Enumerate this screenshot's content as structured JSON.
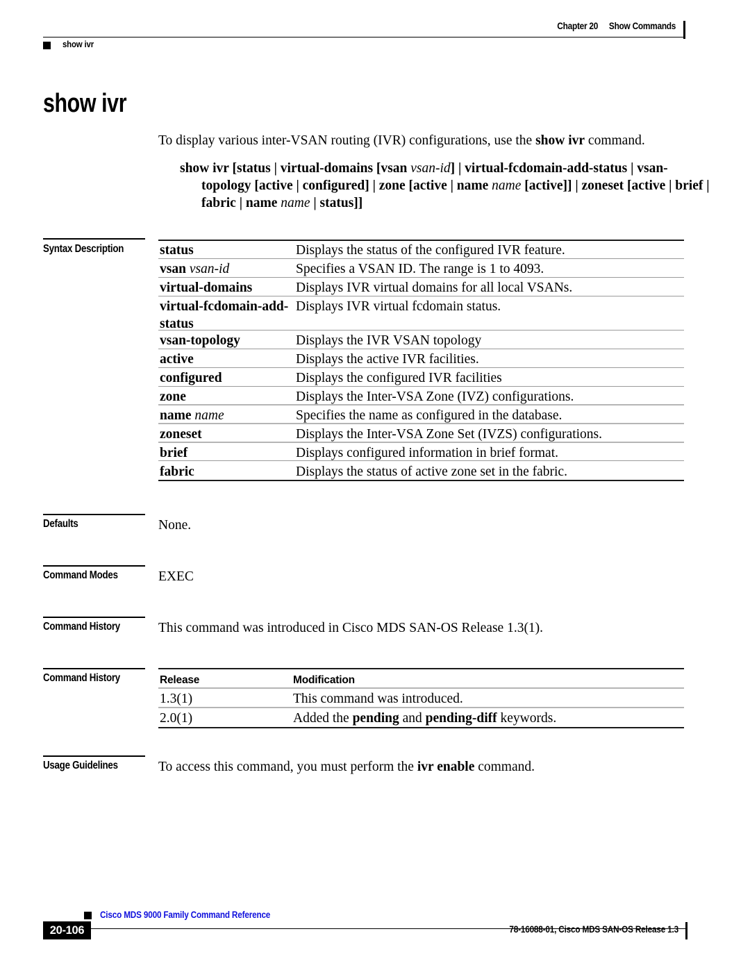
{
  "header": {
    "chapter": "Chapter 20",
    "section": "Show Commands",
    "running_head": "show ivr"
  },
  "title": "show ivr",
  "intro": {
    "prefix": "To display various inter-VSAN routing (IVR) configurations, use the ",
    "command": "show ivr",
    "suffix": " command."
  },
  "syntax": {
    "line1_a": "show ivr [status | virtual-domains [vsan ",
    "line1_i": "vsan-id",
    "line1_b": "] | virtual-fcdomain-add-status | vsan-topology [active | configured] | zone [active | name ",
    "line2_i": "name",
    "line2_b": " [active]] | zoneset [active | brief | fabric | name ",
    "line3_i": "name",
    "line3_b": " | status]]"
  },
  "sections": {
    "syntax_description": "Syntax Description",
    "defaults": "Defaults",
    "command_modes": "Command Modes",
    "command_history": "Command History",
    "command_history2": "Command History",
    "usage_guidelines": "Usage Guidelines"
  },
  "syntax_table": [
    {
      "term": "status",
      "term_italic": "",
      "desc": "Displays the status of the configured IVR feature."
    },
    {
      "term": "vsan",
      "term_italic": "vsan-id",
      "desc": "Specifies a VSAN ID. The range is 1 to 4093."
    },
    {
      "term": "virtual-domains",
      "term_italic": "",
      "desc": "Displays IVR virtual domains for all local VSANs."
    },
    {
      "term": "virtual-fcdomain-add-status",
      "term_italic": "",
      "desc": "Displays IVR virtual fcdomain status."
    },
    {
      "term": "vsan-topology",
      "term_italic": "",
      "desc": "Displays the IVR VSAN topology"
    },
    {
      "term": "active",
      "term_italic": "",
      "desc": "Displays the active IVR facilities."
    },
    {
      "term": "configured",
      "term_italic": "",
      "desc": "Displays the configured IVR facilities"
    },
    {
      "term": "zone",
      "term_italic": "",
      "desc": "Displays the Inter-VSA Zone (IVZ) configurations."
    },
    {
      "term": "name",
      "term_italic": "name",
      "desc": "Specifies the name as configured in the database."
    },
    {
      "term": "zoneset",
      "term_italic": "",
      "desc": "Displays the Inter-VSA Zone Set (IVZS) configurations."
    },
    {
      "term": "brief",
      "term_italic": "",
      "desc": "Displays configured information in brief format."
    },
    {
      "term": "fabric",
      "term_italic": "",
      "desc": "Displays the status of active zone set in the fabric."
    }
  ],
  "defaults_value": "None.",
  "command_modes_value": "EXEC",
  "command_history_text": "This command was introduced in Cisco MDS SAN-OS Release 1.3(1).",
  "history_table": {
    "headers": {
      "release": "Release",
      "modification": "Modification"
    },
    "rows": [
      {
        "release": "1.3(1)",
        "mod_a": "This command was introduced.",
        "mod_b1": "",
        "mod_mid": "",
        "mod_b2": "",
        "mod_tail": ""
      },
      {
        "release": "2.0(1)",
        "mod_a": "Added the ",
        "mod_b1": "pending",
        "mod_mid": " and ",
        "mod_b2": "pending-diff",
        "mod_tail": " keywords."
      }
    ]
  },
  "usage_guidelines_text": {
    "prefix": "To access this command, you must perform the ",
    "command": "ivr enable",
    "suffix": " command."
  },
  "footer": {
    "doc_title": "Cisco MDS 9000 Family Command Reference",
    "page_number": "20-106",
    "doc_id": "78-16088-01, Cisco MDS SAN-OS Release 1.3"
  },
  "colors": {
    "link_blue": "#1111dd",
    "rule_black": "#000000",
    "rule_grey": "#9a9a9a"
  }
}
